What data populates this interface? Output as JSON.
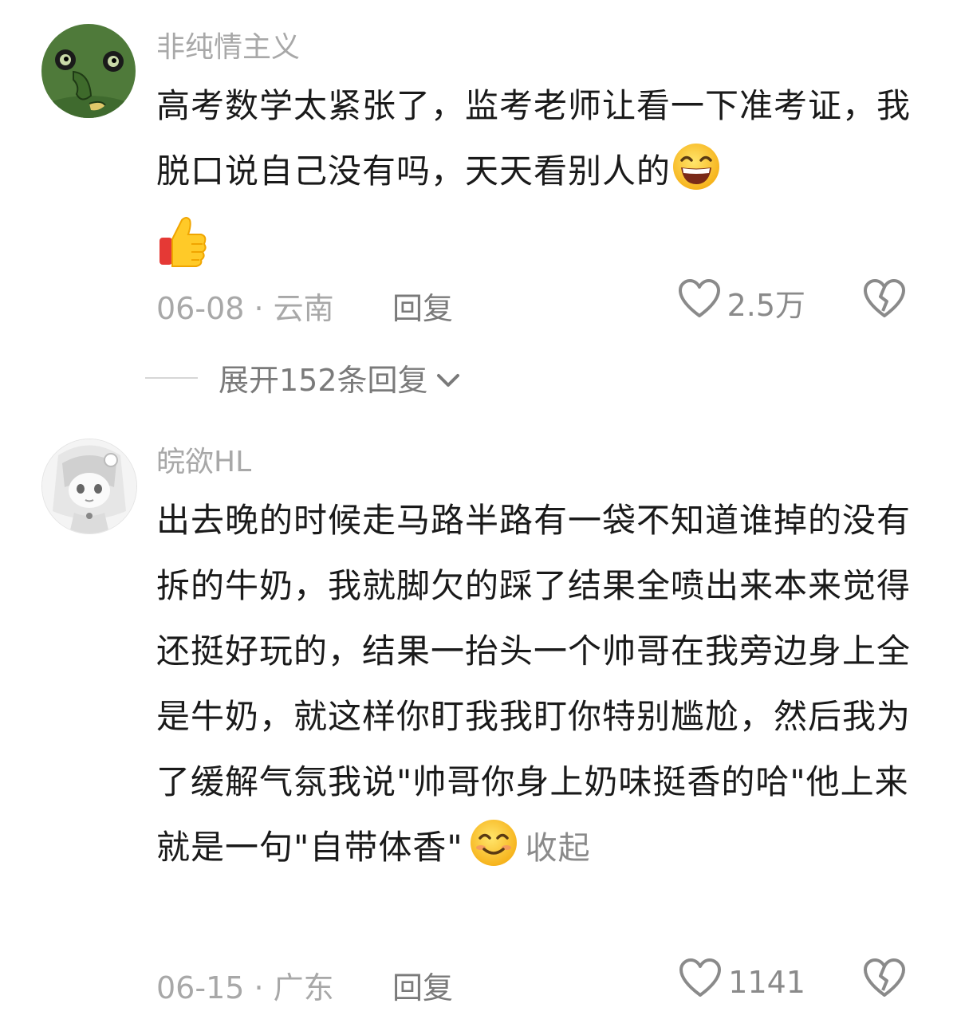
{
  "comments": [
    {
      "username": "非纯情主义",
      "text_parts": [
        "高考数学太紧张了，监考老师让看一下准考证，我脱口说自己没有吗，天天看别人的",
        ""
      ],
      "date_location": "06-08 · 云南",
      "reply_label": "回复",
      "likes": "2.5万",
      "expand_replies": "展开152条回复"
    },
    {
      "username": "皖欲HL",
      "text": "出去晚的时候走马路半路有一袋不知道谁掉的没有拆的牛奶，我就脚欠的踩了结果全喷出来本来觉得还挺好玩的，结果一抬头一个帅哥在我旁边身上全是牛奶，就这样你盯我我盯你特别尴尬，然后我为了缓解气氛我说\"帅哥你身上奶味挺香的哈\"他上来就是一句\"自带体香\"",
      "collapse_label": "收起",
      "date_location": "06-15 · 广东",
      "reply_label": "回复",
      "likes": "1141"
    }
  ],
  "icons": {
    "like": "heart-outline-icon",
    "dislike": "broken-heart-icon",
    "expand": "chevron-down-icon",
    "emoji_grin": "grinning-face-emoji",
    "emoji_thumb": "thumbs-up-emoji",
    "emoji_smile": "smiling-face-emoji"
  },
  "colors": {
    "text": "#1a1a1a",
    "muted": "#a8a8a8",
    "link": "#7a7a7a"
  }
}
